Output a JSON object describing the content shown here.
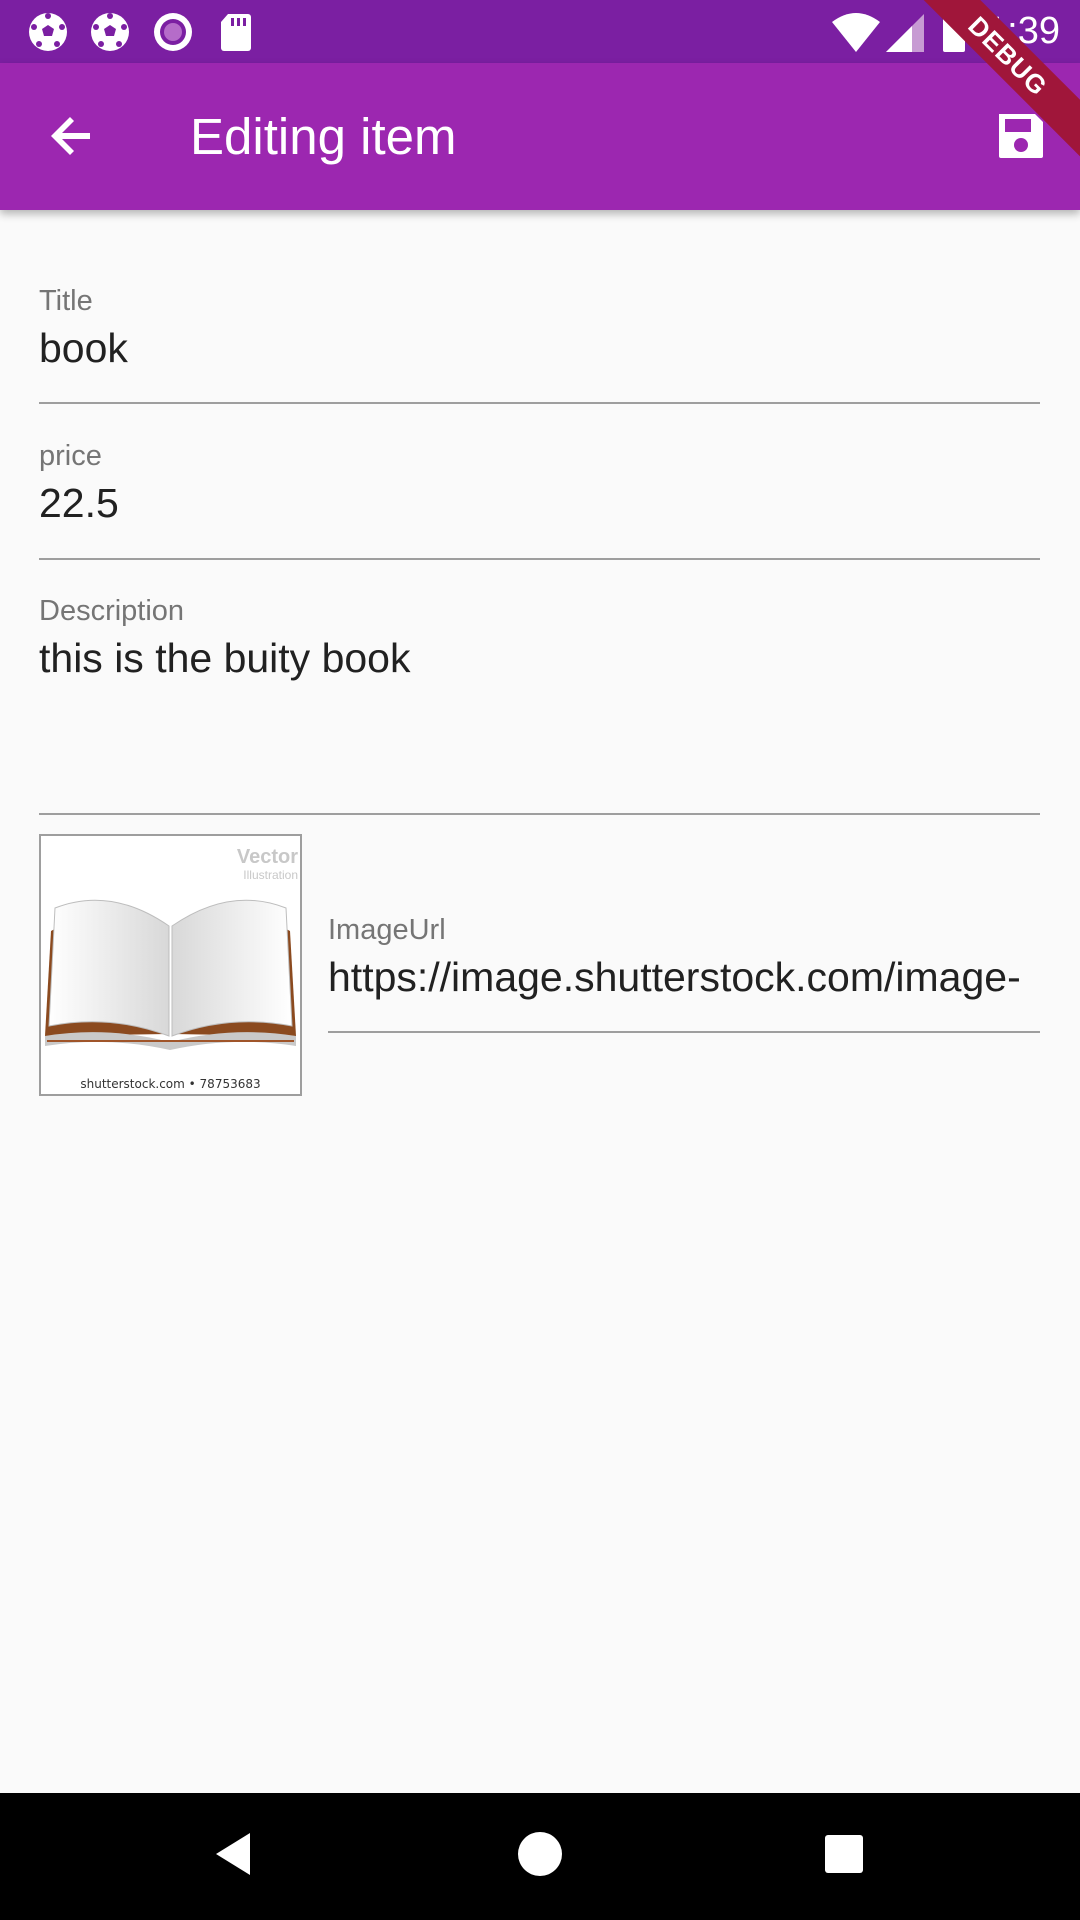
{
  "status": {
    "time": "1:39"
  },
  "appbar": {
    "title": "Editing item"
  },
  "debug": {
    "label": "DEBUG"
  },
  "form": {
    "title_label": "Title",
    "title_value": "book",
    "price_label": "price",
    "price_value": "22.5",
    "description_label": "Description",
    "description_value": "this is the buity book",
    "imageurl_label": "ImageUrl",
    "imageurl_value": "https://image.shutterstock.com/image-"
  },
  "thumbnail": {
    "caption": "shutterstock.com • 78753683",
    "watermark": "Vector",
    "watermark_sub": "Illustration"
  },
  "icons": {
    "status": [
      "soccer-ball-icon",
      "soccer-ball-icon",
      "circle-record-icon",
      "sd-card-icon",
      "wifi-icon",
      "signal-icon",
      "battery-icon"
    ],
    "appbar": [
      "arrow-back-icon",
      "save-icon"
    ],
    "navbar": [
      "nav-back-icon",
      "nav-home-icon",
      "nav-recents-icon"
    ]
  },
  "colors": {
    "status_bar": "#7b1fa2",
    "app_bar": "#9c27b0",
    "debug_banner": "#a0163a",
    "background": "#fafafa",
    "nav_bar": "#000000"
  }
}
